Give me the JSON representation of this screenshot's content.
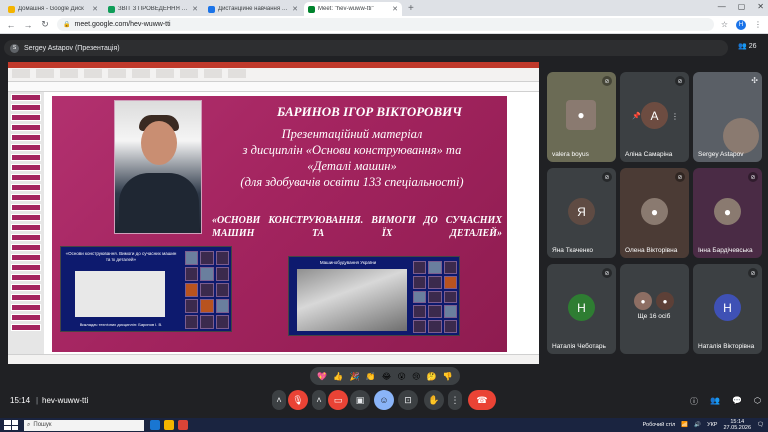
{
  "browser": {
    "tabs": [
      {
        "title": "Домашня - Google Диск",
        "color": "#f4b400",
        "active": false
      },
      {
        "title": "ЗВІТ З ПРОВЕДЕННЯ ТИЖНЯ",
        "color": "#0f9d58",
        "active": false
      },
      {
        "title": "Дистанційне навчання в ВСП",
        "color": "#1a73e8",
        "active": false
      },
      {
        "title": "Meet: \"hev-wuww-tti\"",
        "color": "#00832d",
        "active": true
      }
    ],
    "new_tab": "+",
    "url": "meet.google.com/hev-wuww-tti",
    "profile_initial": "H"
  },
  "meet": {
    "presenter_label": "Sergey Astapov (Презентація)",
    "people_count": "26",
    "time": "15:14",
    "separator": "|",
    "meeting_code": "hev-wuww-tti"
  },
  "slide": {
    "name": "БАРИНОВ ІГОР ВІКТОРОВИЧ",
    "desc_lines": [
      "Презентаційний матеріал",
      "з дисциплін «Основи конструювання» та",
      "«Деталі машин»",
      "(для здобувачів освіти 133 спеціальності)"
    ],
    "subtitle": "«ОСНОВИ КОНСТРУЮВАННЯ. ВИМОГИ ДО СУЧАСНИХ МАШИН ТА ЇХ ДЕТАЛЕЙ»",
    "inset1_caption": "«Основи конструювання. Вимоги до сучасних машин та їх деталей»",
    "inset1_footer": "Викладач технічних дисциплін: Баринов І. В.",
    "inset2_caption": "Машинобудування України"
  },
  "participants": [
    {
      "name": "valera boyus",
      "type": "photo",
      "color": "#6b6b55"
    },
    {
      "name": "Аліна Самаріна",
      "type": "avatar",
      "initial": "А",
      "color": "#6d4c41"
    },
    {
      "name": "Sergey Astapov",
      "type": "photo",
      "color": "#5a5f66"
    },
    {
      "name": "Яна Ткаченко",
      "type": "avatar",
      "initial": "Я",
      "color": "#5f4b43"
    },
    {
      "name": "Олена Вікторівна",
      "type": "photo",
      "color": "#4b3b35"
    },
    {
      "name": "Інна Бардічевська",
      "type": "photo",
      "color": "#4a2b45"
    },
    {
      "name": "Наталія Чеботарь",
      "type": "avatar",
      "initial": "Н",
      "color": "#2e7d32"
    },
    {
      "name": "Ще 16 осіб",
      "type": "group",
      "color": "#3c4043"
    },
    {
      "name": "Наталія Вікторівна",
      "type": "avatar",
      "initial": "Н",
      "color": "#3f51b5"
    }
  ],
  "reactions": [
    "💖",
    "👍",
    "🎉",
    "👏",
    "😂",
    "😮",
    "😢",
    "🤔",
    "👎"
  ],
  "taskbar": {
    "search_placeholder": "Пошук",
    "tray_text": "Робочий стіл",
    "lang": "УКР",
    "clock_time": "15:14",
    "clock_date": "27.05.2026"
  }
}
